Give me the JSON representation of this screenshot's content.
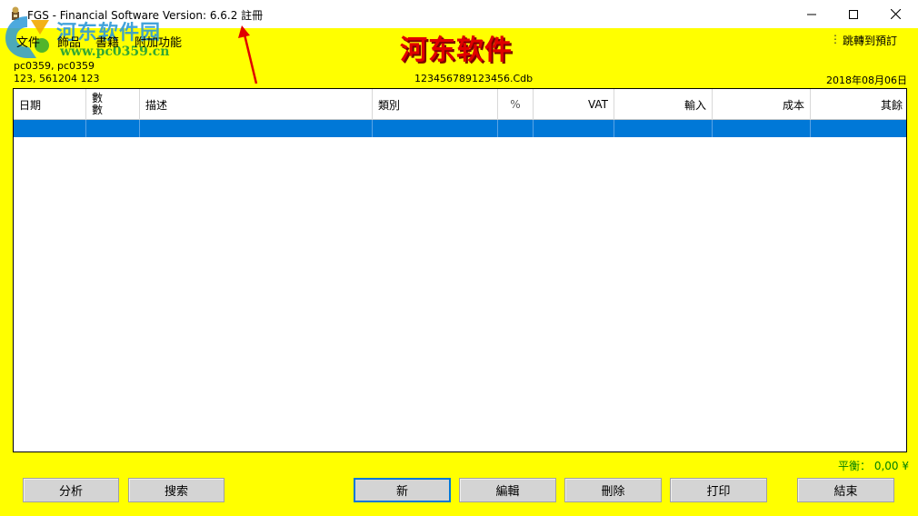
{
  "window": {
    "title": "FGS - Financial Software  Version: 6.6.2  註冊",
    "controls": [
      "minimize-icon",
      "maximize-icon",
      "close-icon"
    ]
  },
  "watermark": {
    "site_name": "河东软件园",
    "url": "www.pc0359.cn"
  },
  "menu": [
    {
      "label": "文件"
    },
    {
      "label": "飾品"
    },
    {
      "label": "書籍"
    },
    {
      "label": "附加功能"
    }
  ],
  "brand": "河东软件",
  "jump_label": "跳轉到預訂",
  "info": {
    "user_line1": "pc0359, pc0359",
    "user_line2": "123, 561204 123",
    "db_file": "123456789123456.Cdb",
    "date": "2018年08月06日"
  },
  "table": {
    "columns": [
      {
        "label": "日期"
      },
      {
        "label": "數\n數"
      },
      {
        "label": "描述"
      },
      {
        "label": "類別"
      },
      {
        "label": "%"
      },
      {
        "label": "VAT"
      },
      {
        "label": "輸入"
      },
      {
        "label": "成本"
      },
      {
        "label": "其餘"
      }
    ],
    "rows": [
      {
        "selected": true,
        "cells": [
          "",
          "",
          "",
          "",
          "",
          "",
          "",
          "",
          ""
        ]
      }
    ]
  },
  "balance": "平衡： 0,00 ¥",
  "buttons": {
    "analyze": "分析",
    "search": "搜索",
    "new": "新",
    "edit": "編輯",
    "delete": "刪除",
    "print": "打印",
    "end": "結束"
  },
  "colors": {
    "background": "#ffff00",
    "selection": "#0078d7",
    "brand": "#e00000",
    "balance": "#008000"
  }
}
